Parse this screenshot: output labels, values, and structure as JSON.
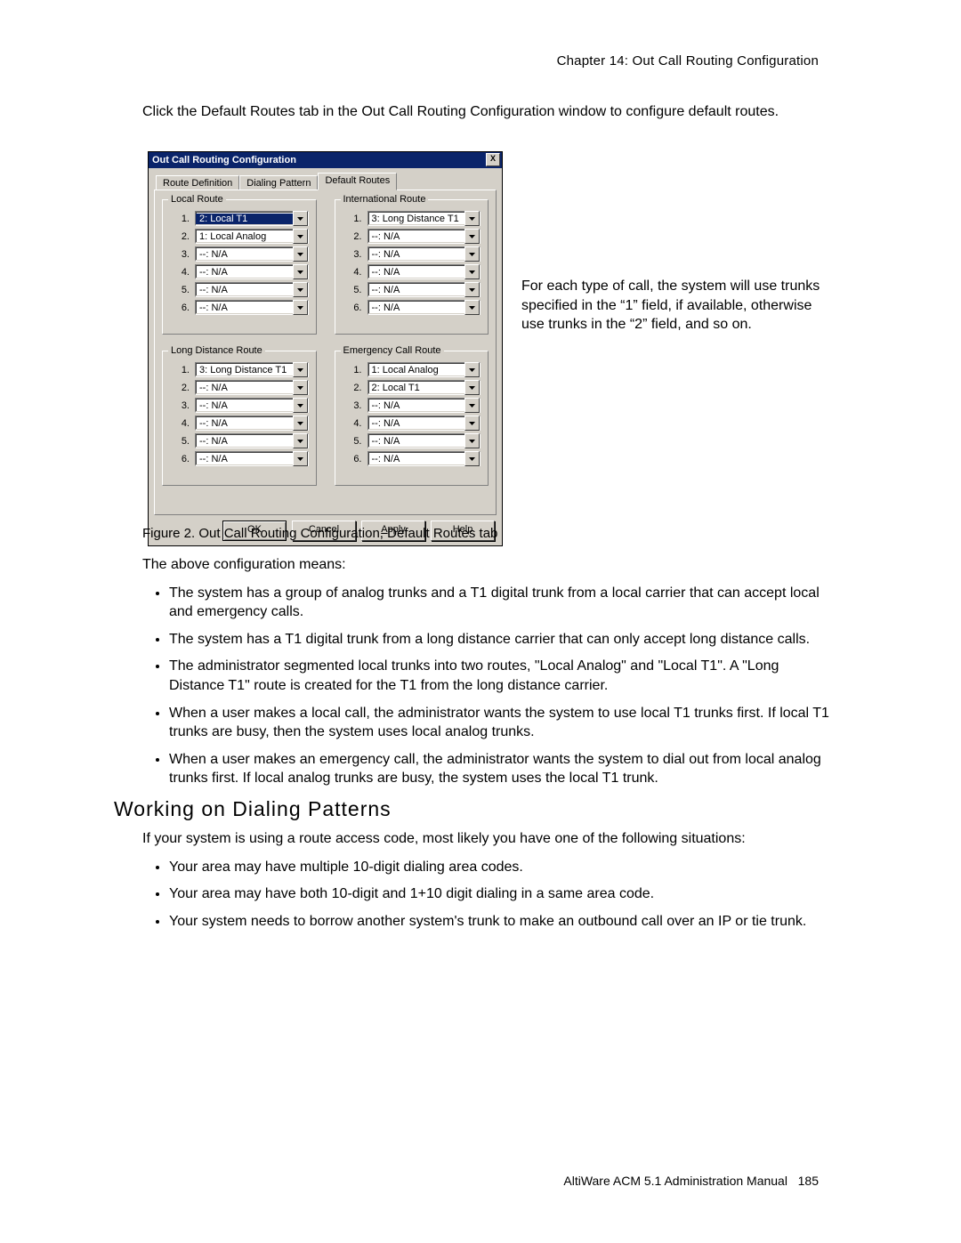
{
  "header": {
    "chapter": "Chapter 14:  Out Call Routing Configuration"
  },
  "intro": "Click the Default Routes tab in the Out Call Routing Configuration window to configure default routes.",
  "dialog": {
    "title": "Out Call Routing Configuration",
    "close": "X",
    "tabs": [
      "Route Definition",
      "Dialing Pattern",
      "Default Routes"
    ],
    "active_tab": 2,
    "groups": {
      "local": {
        "legend": "Local Route",
        "rows": [
          "2: Local T1",
          "1: Local Analog",
          "--: N/A",
          "--: N/A",
          "--: N/A",
          "--: N/A"
        ]
      },
      "intl": {
        "legend": "International Route",
        "rows": [
          "3: Long Distance T1",
          "--: N/A",
          "--: N/A",
          "--: N/A",
          "--: N/A",
          "--: N/A"
        ]
      },
      "longdist": {
        "legend": "Long Distance Route",
        "rows": [
          "3: Long Distance T1",
          "--: N/A",
          "--: N/A",
          "--: N/A",
          "--: N/A",
          "--: N/A"
        ]
      },
      "emerg": {
        "legend": "Emergency Call Route",
        "rows": [
          "1: Local Analog",
          "2: Local T1",
          "--: N/A",
          "--: N/A",
          "--: N/A",
          "--: N/A"
        ]
      }
    },
    "buttons": {
      "ok": "OK",
      "cancel": "Cancel",
      "apply": "Apply",
      "help": "Help",
      "apply_ul": "A",
      "apply_rest": "pply"
    }
  },
  "side_text": "For each type of call, the system will use trunks specified in the “1” field, if available, otherwise use trunks in the “2” field, and so on.",
  "caption": "Figure 2.   Out Call Routing Configuration, Default Routes tab",
  "body1": {
    "lead": "The above configuration means:",
    "bullets": [
      "The system has a group of analog trunks and a T1 digital trunk from a local carrier that can accept local and emergency calls.",
      "The system has a T1 digital trunk from a long distance carrier that can only accept long distance calls.",
      "The administrator segmented local trunks into two routes, \"Local Analog\" and \"Local T1\". A \"Long Distance T1\" route is created for the T1 from the long distance carrier.",
      "When a user makes a local call, the administrator wants the system to use local T1 trunks first. If local T1 trunks are busy, then the system uses local analog trunks.",
      "When a user makes an emergency call, the administrator wants the system to dial out from local analog trunks first. If local analog trunks are busy, the system uses the local T1 trunk."
    ]
  },
  "heading": "Working on Dialing Patterns",
  "body2": {
    "lead": "If your system is using a route access code, most likely you have one of the following situations:",
    "bullets": [
      "Your area may have multiple 10-digit dialing area codes.",
      "Your area may have both 10-digit and 1+10 digit dialing in a same area code.",
      "Your system needs to borrow another system's trunk to make an outbound call over an IP or tie trunk."
    ]
  },
  "footer": {
    "manual": "AltiWare ACM 5.1 Administration Manual",
    "page": "185"
  }
}
